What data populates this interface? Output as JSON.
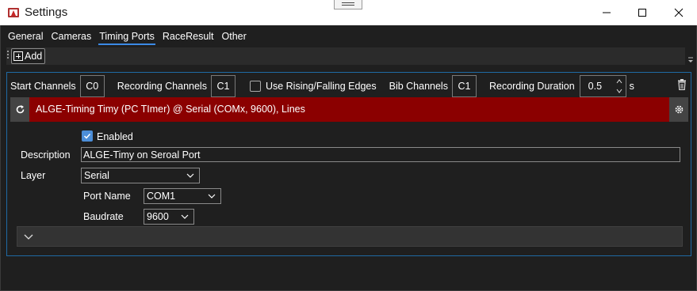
{
  "window": {
    "title": "Settings"
  },
  "tabs": [
    {
      "label": "General",
      "active": false
    },
    {
      "label": "Cameras",
      "active": false
    },
    {
      "label": "Timing Ports",
      "active": true
    },
    {
      "label": "RaceResult",
      "active": false
    },
    {
      "label": "Other",
      "active": false
    }
  ],
  "toolbar": {
    "add_label": "Add"
  },
  "channels": {
    "start_label": "Start Channels",
    "start_value": "C0",
    "recording_label": "Recording Channels",
    "recording_value": "C1",
    "edges_label": "Use Rising/Falling Edges",
    "edges_checked": false,
    "bib_label": "Bib Channels",
    "bib_value": "C1",
    "duration_label": "Recording Duration",
    "duration_value": "0.5",
    "duration_unit": "s"
  },
  "device": {
    "header": "ALGE-Timing Timy (PC TImer) @ Serial (COMx, 9600), Lines",
    "header_color": "#8b0000",
    "enabled_label": "Enabled",
    "enabled_checked": true,
    "description_label": "Description",
    "description_value": "ALGE-Timy on Seroal Port",
    "layer_label": "Layer",
    "layer_value": "Serial",
    "port_name_label": "Port Name",
    "port_name_value": "COM1",
    "baudrate_label": "Baudrate",
    "baudrate_value": "9600"
  },
  "colors": {
    "accent": "#3b8ae6",
    "panel_border": "#1f6aa5",
    "checkbox": "#4c8ed8"
  },
  "icons": {
    "app": "settings-app-icon",
    "minimize": "minimize-icon",
    "maximize": "maximize-icon",
    "close": "close-icon",
    "add": "plus-square-icon",
    "trash": "trash-icon",
    "refresh": "refresh-icon",
    "gear": "gear-icon",
    "expand": "chevron-down-icon"
  }
}
